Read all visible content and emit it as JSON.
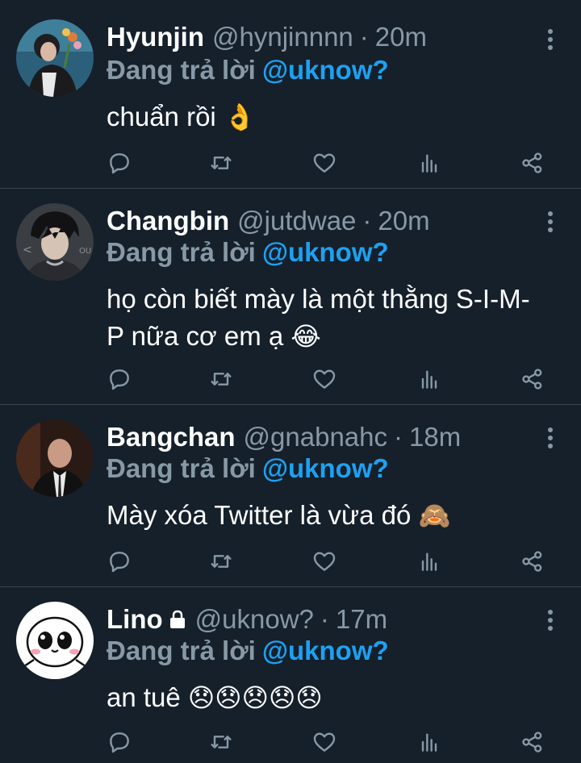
{
  "reply_prefix": "Đang trả lời",
  "colors": {
    "background": "#15202b",
    "accent": "#1da1f2",
    "muted": "#8899a6",
    "divider": "#38444d"
  },
  "icons": [
    "reply-icon",
    "retweet-icon",
    "like-icon",
    "analytics-icon",
    "share-icon",
    "more-icon",
    "lock-icon"
  ],
  "tweets": [
    {
      "name": "Hyunjin",
      "handle": "@hynjinnnn",
      "time": "20m",
      "reply_to": "@uknow?",
      "text": "chuẩn rồi",
      "emoji": "👌",
      "protected": false
    },
    {
      "name": "Changbin",
      "handle": "@jutdwae",
      "time": "20m",
      "reply_to": "@uknow?",
      "text": "họ còn biết mày là một thằng S-I-M-P nữa cơ em ạ",
      "emoji": "😂",
      "protected": false
    },
    {
      "name": "Bangchan",
      "handle": "@gnabnahc",
      "time": "18m",
      "reply_to": "@uknow?",
      "text": "Mày xóa Twitter là vừa đó",
      "emoji": "🙈",
      "protected": false
    },
    {
      "name": "Lino",
      "handle": "@uknow?",
      "time": "17m",
      "reply_to": "@uknow?",
      "text": "an tuê",
      "emoji": "😞😞😞😞😞",
      "protected": true
    }
  ]
}
